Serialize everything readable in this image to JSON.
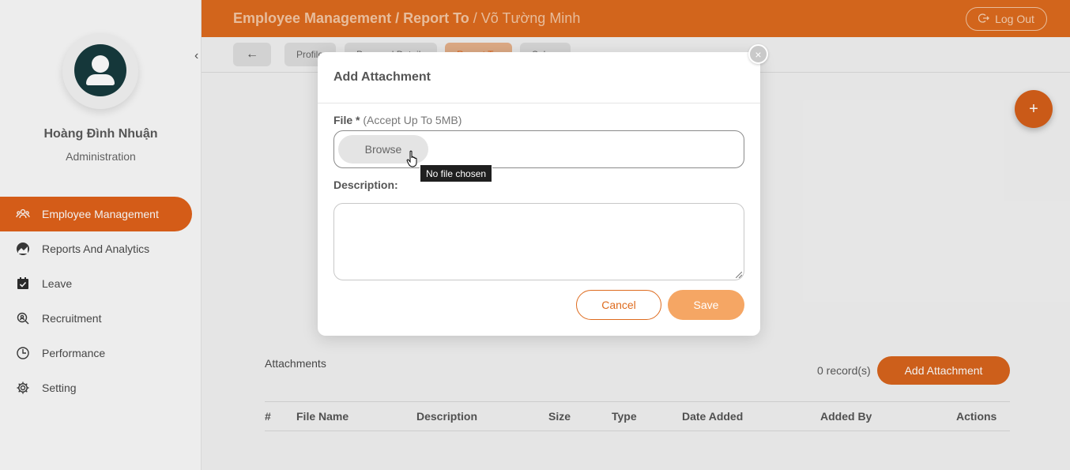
{
  "sidebar": {
    "user_name": "Hoàng Đình Nhuận",
    "user_role": "Administration",
    "items": [
      {
        "label": "Employee Management",
        "icon": "people-icon",
        "active": true
      },
      {
        "label": "Reports And Analytics",
        "icon": "analytics-icon"
      },
      {
        "label": "Leave",
        "icon": "calendar-check-icon"
      },
      {
        "label": "Recruitment",
        "icon": "recruitment-icon"
      },
      {
        "label": "Performance",
        "icon": "performance-icon"
      },
      {
        "label": "Setting",
        "icon": "gear-icon"
      }
    ]
  },
  "header": {
    "crumb1": "Employee Management",
    "sep1": " / ",
    "crumb2": "Report To",
    "sep2": " / ",
    "crumb3": "Võ Tường Minh",
    "logout": "Log Out"
  },
  "tabs": [
    {
      "label": "Profile"
    },
    {
      "label": "Personal Details"
    },
    {
      "label": "Report To",
      "active": true
    },
    {
      "label": "Salary"
    }
  ],
  "attachments": {
    "title": "Attachments",
    "records": "0 record(s)",
    "add_button": "Add Attachment",
    "columns": [
      "#",
      "File Name",
      "Description",
      "Size",
      "Type",
      "Date Added",
      "Added By",
      "Actions"
    ]
  },
  "modal": {
    "title": "Add Attachment",
    "file_label": "File *",
    "file_hint": "(Accept Up To 5MB)",
    "browse": "Browse",
    "tooltip": "No file chosen",
    "description_label": "Description:",
    "cancel": "Cancel",
    "save": "Save"
  },
  "colors": {
    "accent": "#de6b1e",
    "avatar_bg": "#173a3e",
    "save_bg": "#f5a664"
  }
}
